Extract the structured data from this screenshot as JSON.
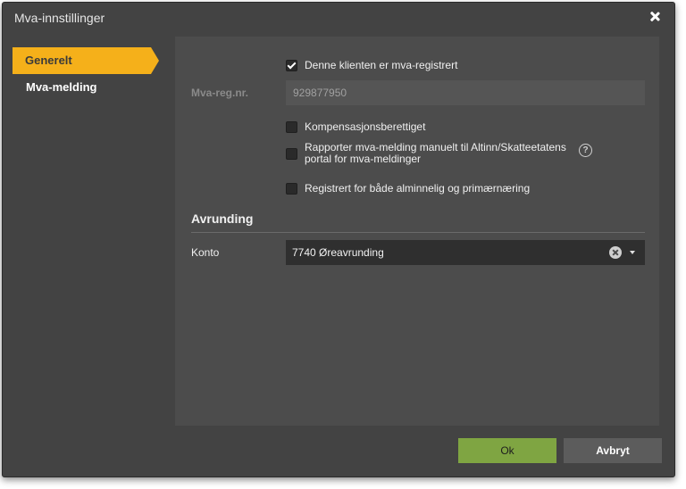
{
  "dialog": {
    "title": "Mva-innstillinger"
  },
  "nav": {
    "items": [
      {
        "label": "Generelt",
        "active": true
      },
      {
        "label": "Mva-melding",
        "active": false
      }
    ]
  },
  "general": {
    "mva_registered": {
      "label": "Denne klienten er mva-registrert",
      "checked": true
    },
    "mva_reg_nr": {
      "label": "Mva-reg.nr.",
      "value": "929877950"
    },
    "compensation": {
      "label": "Kompensasjonsberettiget",
      "checked": false
    },
    "manual_report": {
      "label_line1": "Rapporter mva-melding manuelt til Altinn/Skatteetatens",
      "label_line2": "portal for mva-meldinger",
      "checked": false
    },
    "dual_registration": {
      "label": "Registrert for både alminnelig og primærnæring",
      "checked": false
    }
  },
  "rounding": {
    "section_title": "Avrunding",
    "account": {
      "label": "Konto",
      "value": "7740 Øreavrunding"
    }
  },
  "footer": {
    "ok_label": "Ok",
    "cancel_label": "Avbryt"
  },
  "colors": {
    "accent": "#f5b01a",
    "ok_button": "#7fa542",
    "cancel_button": "#5c5c5c",
    "background": "#434343"
  }
}
